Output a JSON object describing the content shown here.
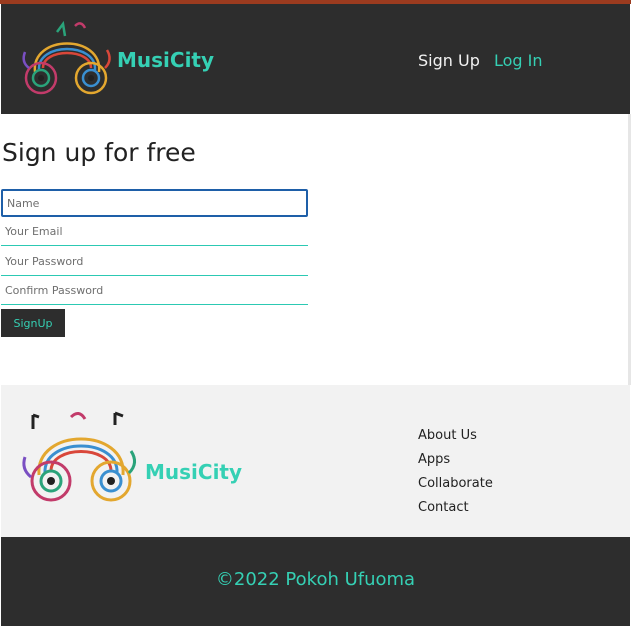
{
  "header": {
    "brand": "MusiCity",
    "logo_icon": "headphones-logo-icon",
    "nav": {
      "signup": "Sign Up",
      "login": "Log In"
    }
  },
  "signup_form": {
    "heading": "Sign up for free",
    "name_placeholder": "Name",
    "email_placeholder": "Your Email",
    "password_placeholder": "Your Password",
    "confirm_placeholder": "Confirm Password",
    "submit_label": "SignUp"
  },
  "footer": {
    "brand": "MusiCity",
    "logo_icon": "headphones-logo-icon",
    "links": [
      "About Us",
      "Apps",
      "Collaborate",
      "Contact"
    ],
    "copyright": "©2022 Pokoh Ufuoma"
  },
  "colors": {
    "accent": "#35d0b4",
    "dark": "#2d2d2d",
    "light_panel": "#f2f2f2",
    "top_strip": "#9b3b1f",
    "focus_border": "#1e5fa8"
  }
}
